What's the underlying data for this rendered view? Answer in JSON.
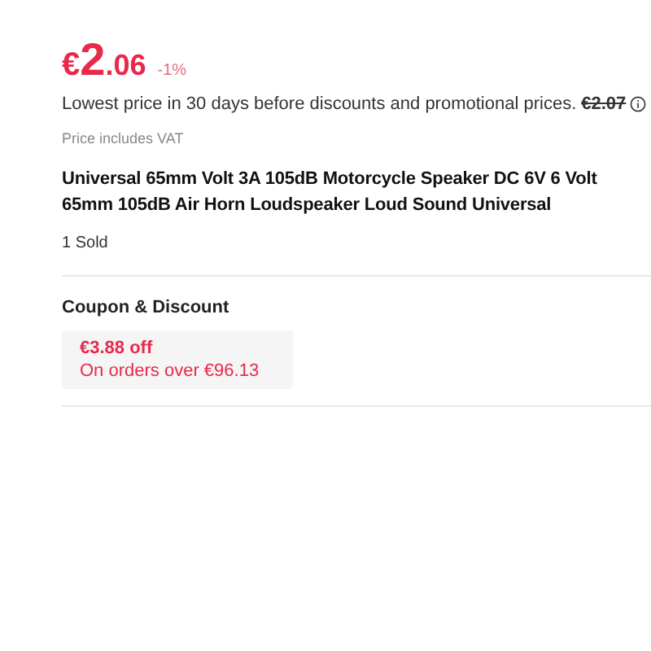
{
  "price": {
    "currency": "€",
    "integer": "2",
    "decimal": ".06",
    "discount": "-1%"
  },
  "lowest_price": {
    "note": "Lowest price in 30 days before discounts and promotional prices.",
    "previous_price": "€2.07"
  },
  "vat_note": "Price includes VAT",
  "title": "Universal 65mm Volt 3A 105dB Motorcycle Speaker DC 6V 6 Volt 65mm 105dB Air Horn Loudspeaker Loud Sound Universal",
  "sold": "1 Sold",
  "coupon_section": {
    "heading": "Coupon & Discount",
    "coupons": [
      {
        "amount": "€3.88 off",
        "condition": "On orders over €96.13"
      }
    ]
  }
}
